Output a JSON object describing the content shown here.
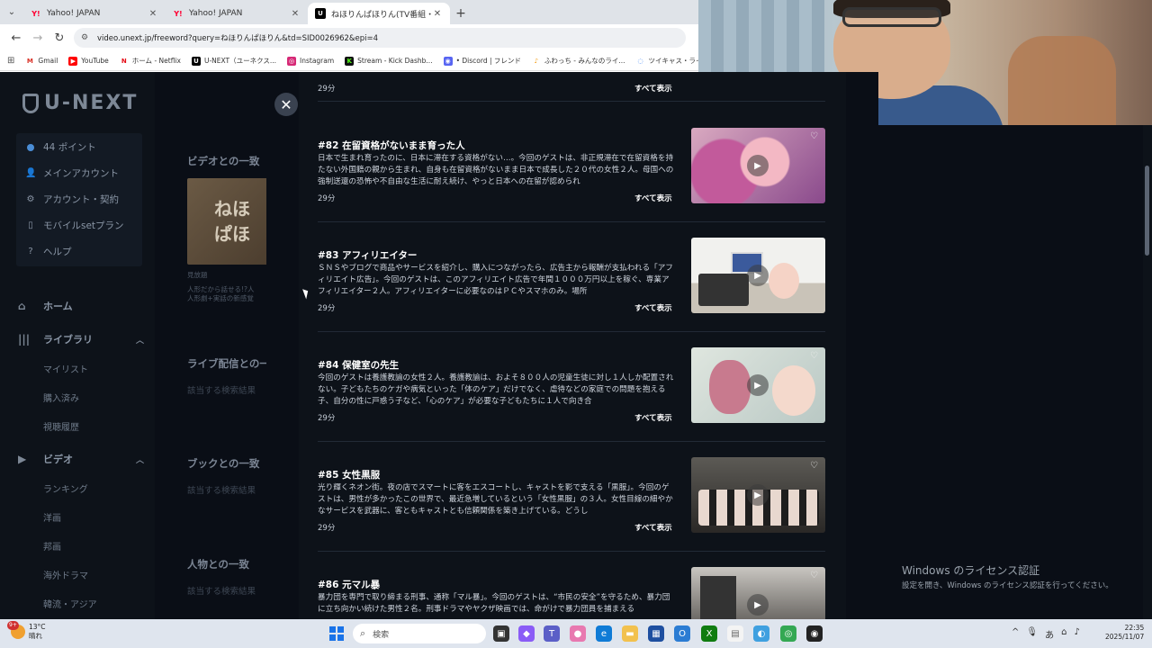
{
  "browser": {
    "tabs": [
      {
        "label": "Yahoo! JAPAN",
        "favicon": "Y!"
      },
      {
        "label": "Yahoo! JAPAN",
        "favicon": "Y!"
      },
      {
        "label": "ねほりんぱほりん(TV番組・エンタメ",
        "favicon": "U"
      }
    ],
    "url": "video.unext.jp/freeword?query=ねほりんぱほりん&td=SID0026962&epi=4",
    "bookmarks": [
      {
        "label": "Gmail",
        "icon": "M",
        "color": "#d93025"
      },
      {
        "label": "YouTube",
        "icon": "▶",
        "color": "#ff0000"
      },
      {
        "label": "ホーム - Netflix",
        "icon": "N",
        "color": "#e50914"
      },
      {
        "label": "U-NEXT（ユーネクス...",
        "icon": "U",
        "color": "#000000"
      },
      {
        "label": "Instagram",
        "icon": "◎",
        "color": "#d62976"
      },
      {
        "label": "Stream - Kick Dashb...",
        "icon": "K",
        "color": "#53fc18"
      },
      {
        "label": "• Discord | フレンド",
        "icon": "◉",
        "color": "#5865f2"
      },
      {
        "label": "ふわっち - みんなのライ...",
        "icon": "♪",
        "color": "#f39c12"
      },
      {
        "label": "ツイキャス・ライブでつ...",
        "icon": "◌",
        "color": "#3b82f6"
      }
    ]
  },
  "sidebar": {
    "logo": "U-NEXT",
    "account": [
      {
        "icon": "dot",
        "label": "44 ポイント",
        "bold": "44"
      },
      {
        "icon": "👤",
        "label": "メインアカウント"
      },
      {
        "icon": "⚙",
        "label": "アカウント・契約"
      },
      {
        "icon": "▭",
        "label": "モバイルsetプラン"
      },
      {
        "icon": "?",
        "label": "ヘルプ"
      }
    ],
    "home": "ホーム",
    "library": "ライブラリ",
    "library_items": [
      "マイリスト",
      "購入済み",
      "視聴履歴"
    ],
    "video": "ビデオ",
    "video_items": [
      "ランキング",
      "洋画",
      "邦画",
      "海外ドラマ",
      "韓流・アジア"
    ]
  },
  "results": {
    "video_heading": "ビデオとの一致",
    "thumb_text": [
      "ねほ",
      "ぱほ"
    ],
    "thumb_meta": [
      "見放題",
      "人形だから話せる!?人",
      "人形劇+実話の新感覚"
    ],
    "live_heading": "ライブ配信との一",
    "live_sub": "該当する検索結果",
    "book_heading": "ブックとの一致",
    "book_sub": "該当する検索結果",
    "person_heading": "人物との一致",
    "person_sub": "該当する検索結果"
  },
  "modal": {
    "top_duration": "29分",
    "top_more": "すべて表示",
    "episodes": [
      {
        "title": "#82 在留資格がないまま育った人",
        "desc": "日本で生まれ育ったのに、日本に滞在する資格がない…。今回のゲストは、非正規滞在で在留資格を持たない外国籍の親から生まれ、自身も在留資格がないまま日本で成長した２０代の女性２人。母国への強制送還の恐怖や不自由な生活に耐え続け、やっと日本への在留が認められ",
        "duration": "29分",
        "more": "すべて表示"
      },
      {
        "title": "#83 アフィリエイター",
        "desc": "ＳＮＳやブログで商品やサービスを紹介し、購入につながったら、広告主から報酬が支払われる「アフィリエイト広告」。今回のゲストは、このアフィリエイト広告で年間１０００万円以上を稼ぐ、専業アフィリエイター２人。アフィリエイターに必要なのはＰＣやスマホのみ。場所",
        "duration": "29分",
        "more": "すべて表示"
      },
      {
        "title": "#84 保健室の先生",
        "desc": "今回のゲストは養護教諭の女性２人。養護教諭は、およそ８００人の児童生徒に対し１人しか配置されない。子どもたちのケガや病気といった「体のケア」だけでなく、虐待などの家庭での問題を抱える子、自分の性に戸惑う子など、「心のケア」が必要な子どもたちに１人で向き合",
        "duration": "29分",
        "more": "すべて表示"
      },
      {
        "title": "#85 女性黒服",
        "desc": "光り輝くネオン街。夜の店でスマートに客をエスコートし、キャストを影で支える「黒服」。今回のゲストは、男性が多かったこの世界で、最近急増しているという「女性黒服」の３人。女性目線の細やかなサービスを武器に、客ともキャストとも信頼関係を築き上げている。どうし",
        "duration": "29分",
        "more": "すべて表示"
      },
      {
        "title": "#86 元マル暴",
        "desc": "暴力団を専門で取り締まる刑事、通称「マル暴」。今回のゲストは、“市民の安全”を守るため、暴力団に立ち向かい続けた男性２名。刑事ドラマやヤクザ映画では、命がけで暴力団員を捕まえる",
        "duration": "",
        "more": ""
      }
    ]
  },
  "windows": {
    "activate_title": "Windows のライセンス認証",
    "activate_sub": "設定を開き、Windows のライセンス認証を行ってください。"
  },
  "taskbar": {
    "temp": "13°C",
    "weather": "晴れ",
    "weather_badge": "9+",
    "search_placeholder": "検索",
    "time": "22:35",
    "date": "2025/11/07"
  }
}
